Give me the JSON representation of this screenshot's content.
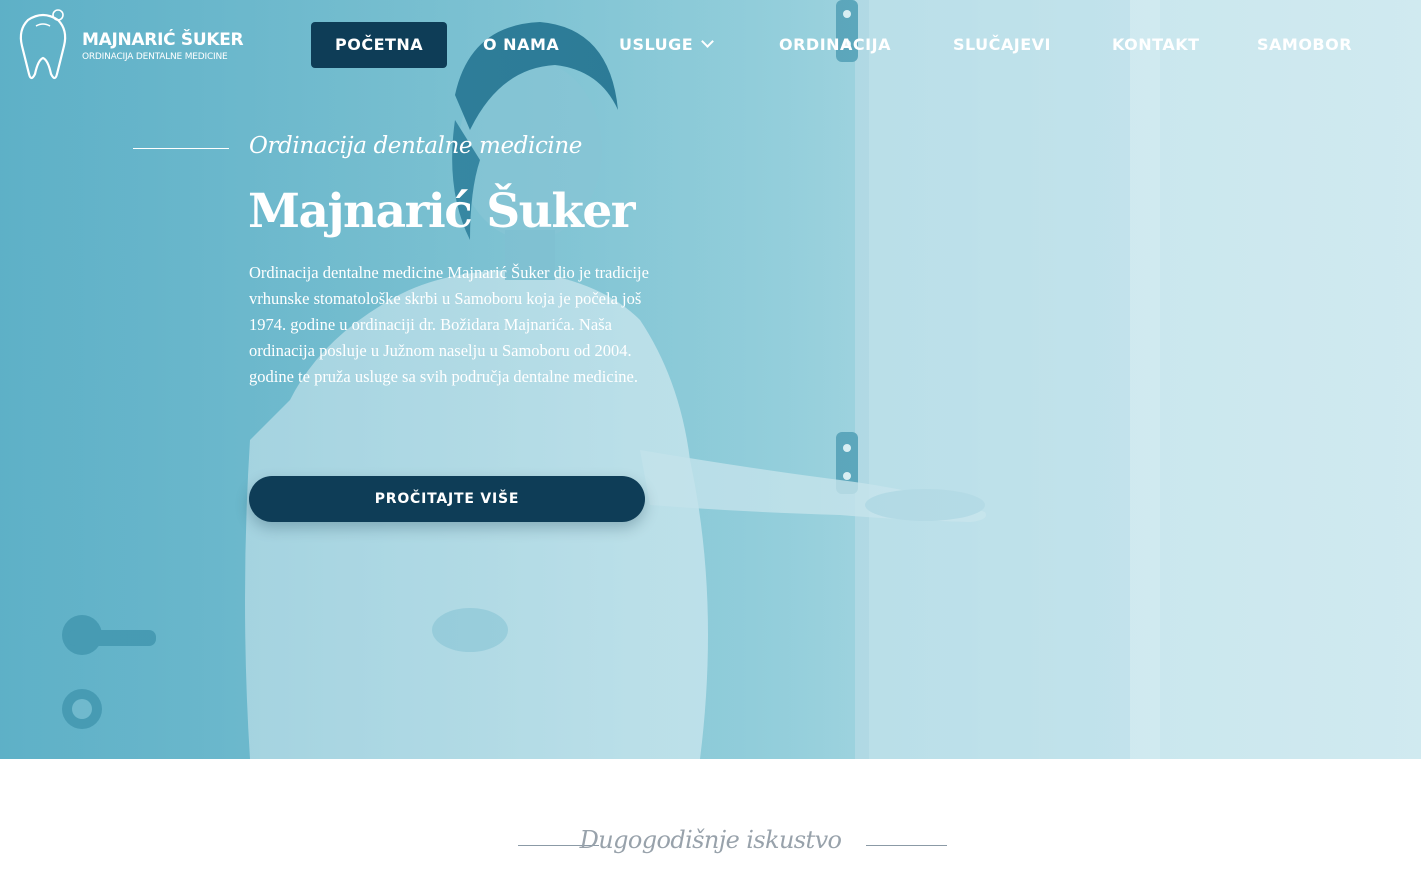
{
  "brand": {
    "name": "MAJNARIĆ ŠUKER",
    "subtitle": "ORDINACIJA DENTALNE MEDICINE",
    "logo_icon": "tooth-icon"
  },
  "nav": {
    "items": [
      {
        "label": "POČETNA",
        "active": true
      },
      {
        "label": "O NAMA"
      },
      {
        "label": "USLUGE",
        "has_dropdown": true,
        "icon": "chevron-down-icon"
      },
      {
        "label": "ORDINACIJA"
      },
      {
        "label": "SLUČAJEVI"
      },
      {
        "label": "KONTAKT"
      },
      {
        "label": "SAMOBOR"
      }
    ]
  },
  "hero": {
    "kicker": "Ordinacija dentalne medicine",
    "title": "Majnarić Šuker",
    "text": "Ordinacija dentalne medicine Majnarić Šuker dio je tradicije vrhunske stomatološke skrbi u Samoboru koja je počela još 1974. godine u ordinaciji dr. Božidara Majnarića. Naša ordinacija posluje u Južnom naselju u Samoboru od 2004. godine te pruža usluge sa svih područja dentalne medicine.",
    "cta_label": "PROČITAJTE VIŠE"
  },
  "section": {
    "heading": "Dugogodišnje iskustvo"
  },
  "colors": {
    "primary": "#0e3d57",
    "hero_tint": "#7dc2d2",
    "muted_text": "#98a2ab"
  }
}
